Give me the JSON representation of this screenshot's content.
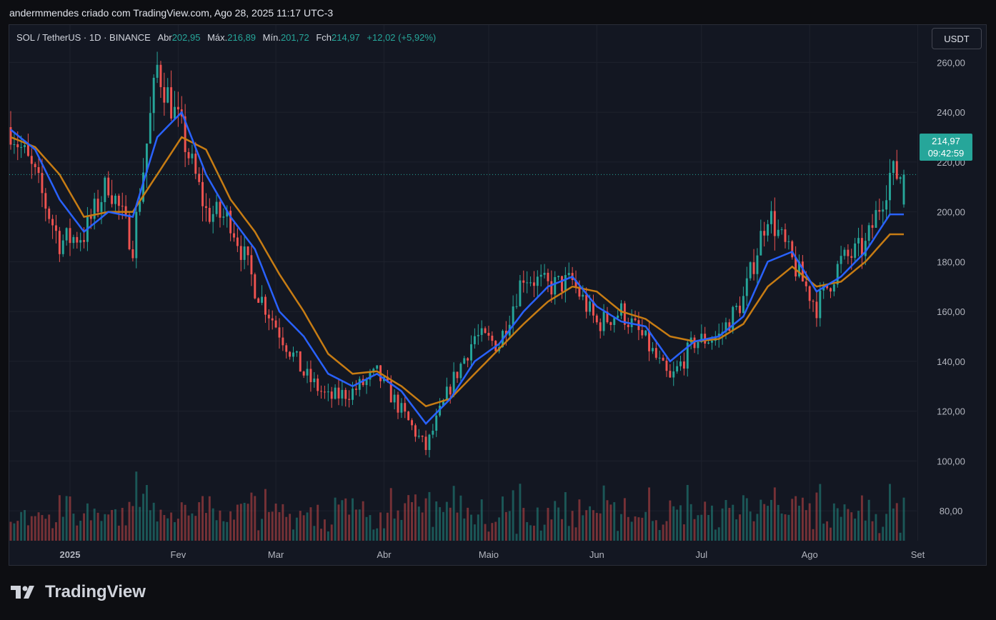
{
  "caption": "andermmendes criado com TradingView.com, Ago 28, 2025 11:17 UTC-3",
  "legend": {
    "symbol": "SOL / TetherUS · 1D · BINANCE",
    "open_label": "Abr",
    "open_value": "202,95",
    "high_label": "Máx.",
    "high_value": "216,89",
    "low_label": "Mín.",
    "low_value": "201,72",
    "close_label": "Fch",
    "close_value": "214,97",
    "change": "+12,02 (+5,92%)"
  },
  "currency_button": "USDT",
  "last_price": {
    "price": "214,97",
    "countdown": "09:42:59"
  },
  "brand": "TradingView",
  "colors": {
    "up": "#26a69a",
    "down": "#ef5350",
    "ma_fast": "#2962ff",
    "ma_slow": "#c77c13",
    "grid": "#1e222d",
    "axis_text": "#b2b5be"
  },
  "chart_data": {
    "type": "candlestick",
    "x_ticks": [
      "2025",
      "Fev",
      "Mar",
      "Abr",
      "Maio",
      "Jun",
      "Jul",
      "Ago",
      "Set"
    ],
    "y_ticks": [
      "80,00",
      "100,00",
      "120,00",
      "140,00",
      "160,00",
      "180,00",
      "200,00",
      "220,00",
      "240,00",
      "260,00"
    ],
    "ylim": [
      68,
      275
    ],
    "legend": "none",
    "grid": true,
    "weekly_close": [
      {
        "date": "2024-12-15",
        "value": 234
      },
      {
        "date": "2024-12-22",
        "value": 214
      },
      {
        "date": "2024-12-29",
        "value": 188
      },
      {
        "date": "2025-01-05",
        "value": 191
      },
      {
        "date": "2025-01-12",
        "value": 212
      },
      {
        "date": "2025-01-19",
        "value": 187
      },
      {
        "date": "2025-01-26",
        "value": 258
      },
      {
        "date": "2025-02-02",
        "value": 232
      },
      {
        "date": "2025-02-09",
        "value": 200
      },
      {
        "date": "2025-02-16",
        "value": 197
      },
      {
        "date": "2025-02-23",
        "value": 170
      },
      {
        "date": "2025-03-02",
        "value": 152
      },
      {
        "date": "2025-03-09",
        "value": 135
      },
      {
        "date": "2025-03-16",
        "value": 125
      },
      {
        "date": "2025-03-23",
        "value": 128
      },
      {
        "date": "2025-03-30",
        "value": 135
      },
      {
        "date": "2025-04-06",
        "value": 120
      },
      {
        "date": "2025-04-13",
        "value": 105
      },
      {
        "date": "2025-04-20",
        "value": 130
      },
      {
        "date": "2025-04-27",
        "value": 150
      },
      {
        "date": "2025-05-04",
        "value": 147
      },
      {
        "date": "2025-05-11",
        "value": 175
      },
      {
        "date": "2025-05-18",
        "value": 170
      },
      {
        "date": "2025-05-25",
        "value": 172
      },
      {
        "date": "2025-06-01",
        "value": 155
      },
      {
        "date": "2025-06-08",
        "value": 160
      },
      {
        "date": "2025-06-15",
        "value": 148
      },
      {
        "date": "2025-06-22",
        "value": 132
      },
      {
        "date": "2025-06-29",
        "value": 148
      },
      {
        "date": "2025-07-06",
        "value": 150
      },
      {
        "date": "2025-07-13",
        "value": 165
      },
      {
        "date": "2025-07-20",
        "value": 200
      },
      {
        "date": "2025-07-27",
        "value": 180
      },
      {
        "date": "2025-08-03",
        "value": 162
      },
      {
        "date": "2025-08-10",
        "value": 180
      },
      {
        "date": "2025-08-17",
        "value": 186
      },
      {
        "date": "2025-08-24",
        "value": 215
      }
    ],
    "ma_fast_weekly": [
      233,
      225,
      205,
      192,
      200,
      198,
      230,
      240,
      215,
      198,
      185,
      160,
      150,
      135,
      130,
      135,
      128,
      115,
      125,
      140,
      147,
      160,
      170,
      174,
      162,
      156,
      154,
      140,
      148,
      150,
      158,
      180,
      184,
      168,
      174,
      184,
      199
    ],
    "ma_slow_weekly": [
      230,
      226,
      215,
      198,
      200,
      200,
      215,
      230,
      225,
      205,
      192,
      175,
      160,
      143,
      135,
      136,
      130,
      122,
      125,
      135,
      145,
      155,
      164,
      170,
      168,
      160,
      157,
      150,
      148,
      149,
      155,
      170,
      178,
      170,
      172,
      180,
      191
    ]
  }
}
